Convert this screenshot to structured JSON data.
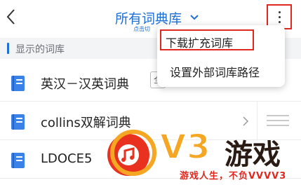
{
  "header": {
    "title": "所有词典库",
    "subtitle": "点击切",
    "back_icon": "chevron-left-icon",
    "more_icon": "more-vertical-icon",
    "accent_color": "#1e6fd6",
    "highlight_color": "#e0281f"
  },
  "section": {
    "label": "显示的词库"
  },
  "rows": [
    {
      "label": "英汉－汉英词典",
      "tag": "全",
      "icon": "book-icon"
    },
    {
      "label": "collins双解词典",
      "icon": "book-icon"
    },
    {
      "label": "LDOCE5",
      "icon": "book-icon"
    }
  ],
  "menu": {
    "items": [
      {
        "label": "下载扩充词库"
      },
      {
        "label": "设置外部词库路径"
      }
    ]
  },
  "watermark": {
    "brand": "V3",
    "name": "游戏",
    "slogan": "游戏人生，不负VVVV3"
  }
}
